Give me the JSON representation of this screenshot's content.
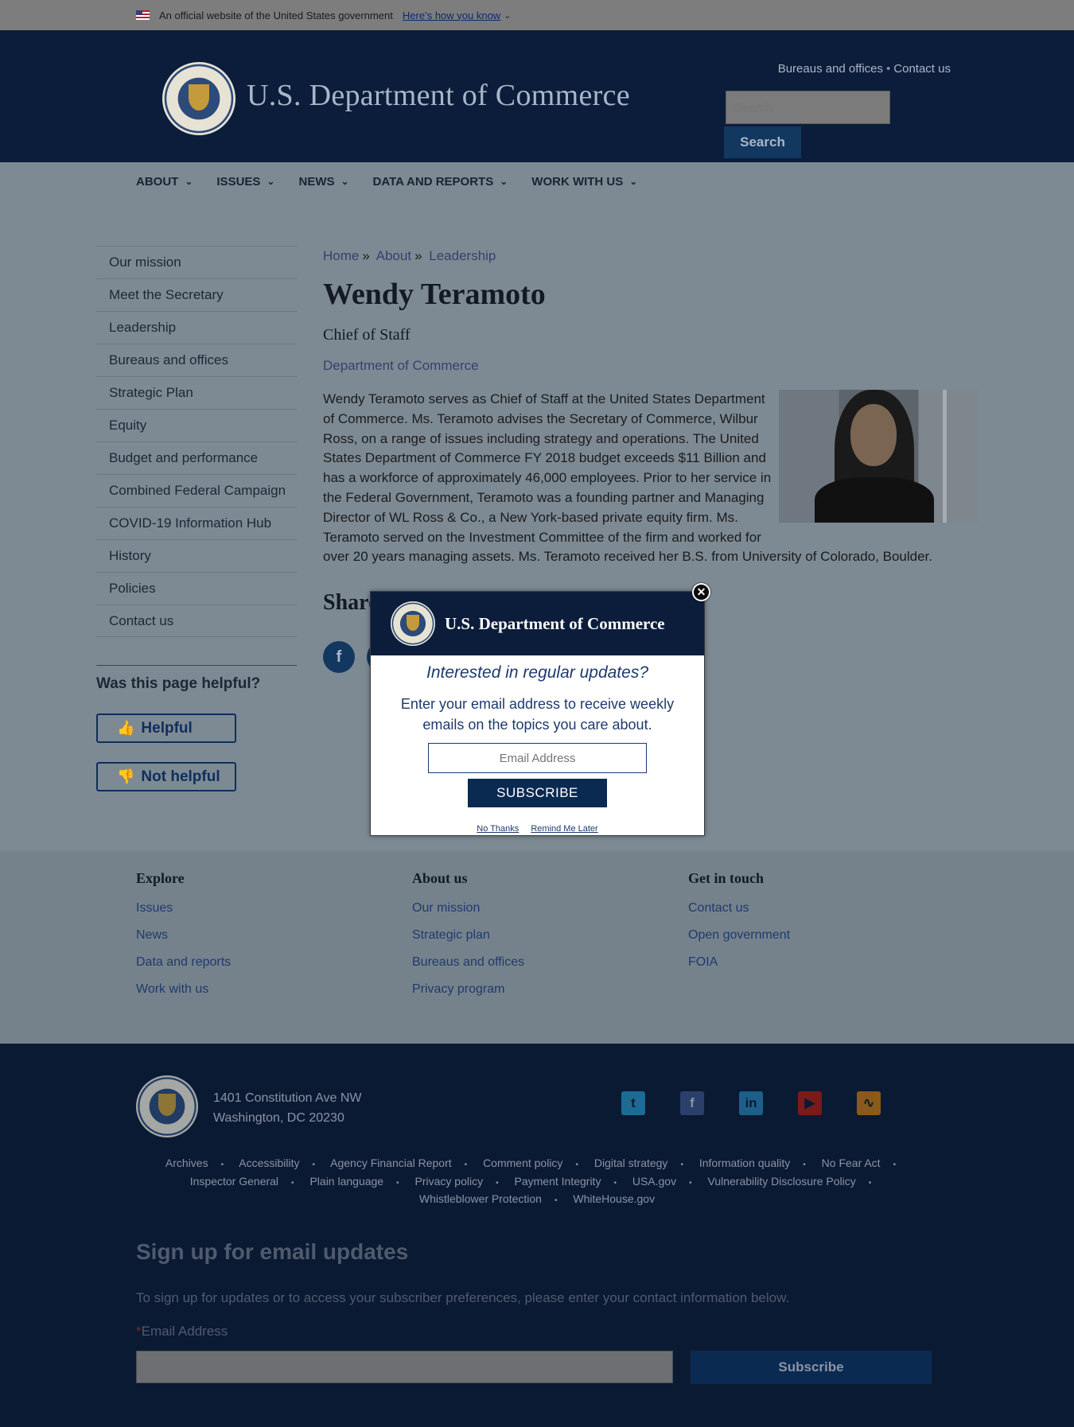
{
  "gov_banner": {
    "text": "An official website of the United States government",
    "how_link": "Here’s how you know"
  },
  "header": {
    "site_title": "U.S. Department of Commerce",
    "top_links": [
      "Bureaus and offices",
      "Contact us"
    ],
    "search_placeholder": "Search",
    "search_button": "Search"
  },
  "main_nav": [
    "ABOUT",
    "ISSUES",
    "NEWS",
    "DATA AND REPORTS",
    "WORK WITH US"
  ],
  "sidebar": {
    "items": [
      "Our mission",
      "Meet the Secretary",
      "Leadership",
      "Bureaus and offices",
      "Strategic Plan",
      "Equity",
      "Budget and performance",
      "Combined Federal Campaign",
      "COVID-19 Information Hub",
      "History",
      "Policies",
      "Contact us"
    ],
    "helpful_question": "Was this page helpful?",
    "helpful_label": "Helpful",
    "not_helpful_label": "Not helpful"
  },
  "breadcrumb": [
    "Home",
    "About",
    "Leadership"
  ],
  "profile": {
    "name": "Wendy Teramoto",
    "title": "Chief of Staff",
    "org": "Department of Commerce",
    "bio": "Wendy Teramoto serves as Chief of Staff at the United States Department of Commerce.  Ms. Teramoto advises the Secretary of Commerce, Wilbur Ross, on a range of issues including strategy and operations.  The United States Department of Commerce FY 2018 budget exceeds $11 Billion and has a workforce of approximately 46,000 employees. Prior to her service in the Federal Government, Teramoto was a founding partner and Managing Director of WL Ross & Co., a New York-based private equity firm.  Ms. Teramoto served on the Investment Committee of the firm and worked for",
    "bio_end": "over 20 years managing assets.  Ms. Teramoto received her B.S. from University of Colorado, Boulder.",
    "share_heading": "Share"
  },
  "modal": {
    "title": "U.S. Department of Commerce",
    "question": "Interested in regular updates?",
    "subtitle": "Enter your email address to receive weekly emails on the topics you care about.",
    "email_placeholder": "Email Address",
    "subscribe": "SUBSCRIBE",
    "no_thanks": "No Thanks",
    "remind_later": "Remind Me Later"
  },
  "footer_links": {
    "explore": {
      "heading": "Explore",
      "links": [
        "Issues",
        "News",
        "Data and reports",
        "Work with us"
      ]
    },
    "about": {
      "heading": "About us",
      "links": [
        "Our mission",
        "Strategic plan",
        "Bureaus and offices",
        "Privacy program"
      ]
    },
    "contact": {
      "heading": "Get in touch",
      "links": [
        "Contact us",
        "Open government",
        "FOIA"
      ]
    }
  },
  "dark_footer": {
    "address_line1": "1401 Constitution Ave NW",
    "address_line2": "Washington, DC 20230",
    "social_icons": [
      "twitter-icon",
      "facebook-icon",
      "linkedin-icon",
      "youtube-icon",
      "rss-icon"
    ],
    "legal_row1": [
      "Archives",
      "Accessibility",
      "Agency Financial Report",
      "Comment policy",
      "Digital strategy",
      "Information quality",
      "No Fear Act"
    ],
    "legal_row2": [
      "Inspector General",
      "Plain language",
      "Privacy policy",
      "Payment Integrity",
      "USA.gov",
      "Vulnerability Disclosure Policy"
    ],
    "legal_row3": [
      "Whistleblower Protection",
      "WhiteHouse.gov"
    ]
  },
  "signup": {
    "title": "Sign up for email updates",
    "text": "To sign up for updates or to access your subscriber preferences, please enter your contact information below.",
    "email_label": "Email Address",
    "required_mark": "*",
    "button": "Subscribe"
  },
  "colors": {
    "header_bg": "#0b1d3a",
    "footer_bg": "#0b1a33",
    "accent": "#12385f"
  }
}
